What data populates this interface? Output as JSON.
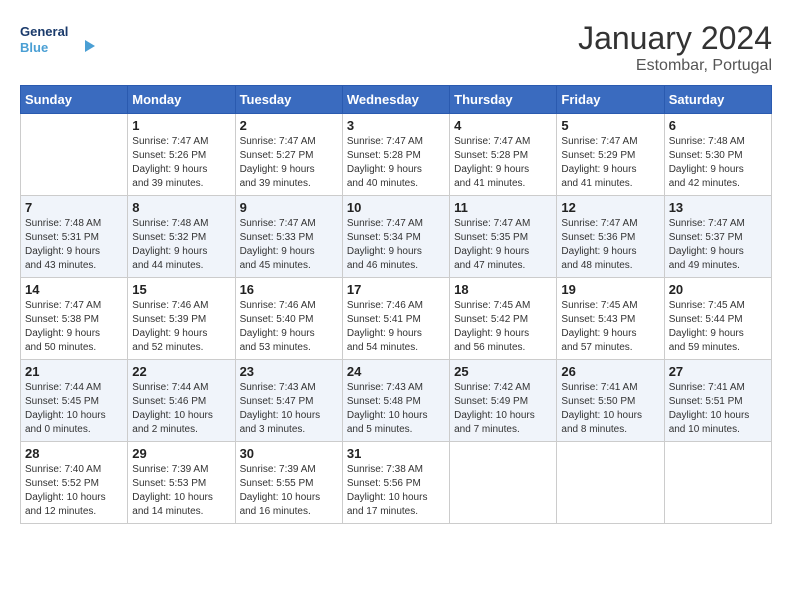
{
  "header": {
    "logo_line1": "General",
    "logo_line2": "Blue",
    "month": "January 2024",
    "location": "Estombar, Portugal"
  },
  "weekdays": [
    "Sunday",
    "Monday",
    "Tuesday",
    "Wednesday",
    "Thursday",
    "Friday",
    "Saturday"
  ],
  "weeks": [
    [
      {
        "day": "",
        "info": ""
      },
      {
        "day": "1",
        "info": "Sunrise: 7:47 AM\nSunset: 5:26 PM\nDaylight: 9 hours\nand 39 minutes."
      },
      {
        "day": "2",
        "info": "Sunrise: 7:47 AM\nSunset: 5:27 PM\nDaylight: 9 hours\nand 39 minutes."
      },
      {
        "day": "3",
        "info": "Sunrise: 7:47 AM\nSunset: 5:28 PM\nDaylight: 9 hours\nand 40 minutes."
      },
      {
        "day": "4",
        "info": "Sunrise: 7:47 AM\nSunset: 5:28 PM\nDaylight: 9 hours\nand 41 minutes."
      },
      {
        "day": "5",
        "info": "Sunrise: 7:47 AM\nSunset: 5:29 PM\nDaylight: 9 hours\nand 41 minutes."
      },
      {
        "day": "6",
        "info": "Sunrise: 7:48 AM\nSunset: 5:30 PM\nDaylight: 9 hours\nand 42 minutes."
      }
    ],
    [
      {
        "day": "7",
        "info": "Sunrise: 7:48 AM\nSunset: 5:31 PM\nDaylight: 9 hours\nand 43 minutes."
      },
      {
        "day": "8",
        "info": "Sunrise: 7:48 AM\nSunset: 5:32 PM\nDaylight: 9 hours\nand 44 minutes."
      },
      {
        "day": "9",
        "info": "Sunrise: 7:47 AM\nSunset: 5:33 PM\nDaylight: 9 hours\nand 45 minutes."
      },
      {
        "day": "10",
        "info": "Sunrise: 7:47 AM\nSunset: 5:34 PM\nDaylight: 9 hours\nand 46 minutes."
      },
      {
        "day": "11",
        "info": "Sunrise: 7:47 AM\nSunset: 5:35 PM\nDaylight: 9 hours\nand 47 minutes."
      },
      {
        "day": "12",
        "info": "Sunrise: 7:47 AM\nSunset: 5:36 PM\nDaylight: 9 hours\nand 48 minutes."
      },
      {
        "day": "13",
        "info": "Sunrise: 7:47 AM\nSunset: 5:37 PM\nDaylight: 9 hours\nand 49 minutes."
      }
    ],
    [
      {
        "day": "14",
        "info": "Sunrise: 7:47 AM\nSunset: 5:38 PM\nDaylight: 9 hours\nand 50 minutes."
      },
      {
        "day": "15",
        "info": "Sunrise: 7:46 AM\nSunset: 5:39 PM\nDaylight: 9 hours\nand 52 minutes."
      },
      {
        "day": "16",
        "info": "Sunrise: 7:46 AM\nSunset: 5:40 PM\nDaylight: 9 hours\nand 53 minutes."
      },
      {
        "day": "17",
        "info": "Sunrise: 7:46 AM\nSunset: 5:41 PM\nDaylight: 9 hours\nand 54 minutes."
      },
      {
        "day": "18",
        "info": "Sunrise: 7:45 AM\nSunset: 5:42 PM\nDaylight: 9 hours\nand 56 minutes."
      },
      {
        "day": "19",
        "info": "Sunrise: 7:45 AM\nSunset: 5:43 PM\nDaylight: 9 hours\nand 57 minutes."
      },
      {
        "day": "20",
        "info": "Sunrise: 7:45 AM\nSunset: 5:44 PM\nDaylight: 9 hours\nand 59 minutes."
      }
    ],
    [
      {
        "day": "21",
        "info": "Sunrise: 7:44 AM\nSunset: 5:45 PM\nDaylight: 10 hours\nand 0 minutes."
      },
      {
        "day": "22",
        "info": "Sunrise: 7:44 AM\nSunset: 5:46 PM\nDaylight: 10 hours\nand 2 minutes."
      },
      {
        "day": "23",
        "info": "Sunrise: 7:43 AM\nSunset: 5:47 PM\nDaylight: 10 hours\nand 3 minutes."
      },
      {
        "day": "24",
        "info": "Sunrise: 7:43 AM\nSunset: 5:48 PM\nDaylight: 10 hours\nand 5 minutes."
      },
      {
        "day": "25",
        "info": "Sunrise: 7:42 AM\nSunset: 5:49 PM\nDaylight: 10 hours\nand 7 minutes."
      },
      {
        "day": "26",
        "info": "Sunrise: 7:41 AM\nSunset: 5:50 PM\nDaylight: 10 hours\nand 8 minutes."
      },
      {
        "day": "27",
        "info": "Sunrise: 7:41 AM\nSunset: 5:51 PM\nDaylight: 10 hours\nand 10 minutes."
      }
    ],
    [
      {
        "day": "28",
        "info": "Sunrise: 7:40 AM\nSunset: 5:52 PM\nDaylight: 10 hours\nand 12 minutes."
      },
      {
        "day": "29",
        "info": "Sunrise: 7:39 AM\nSunset: 5:53 PM\nDaylight: 10 hours\nand 14 minutes."
      },
      {
        "day": "30",
        "info": "Sunrise: 7:39 AM\nSunset: 5:55 PM\nDaylight: 10 hours\nand 16 minutes."
      },
      {
        "day": "31",
        "info": "Sunrise: 7:38 AM\nSunset: 5:56 PM\nDaylight: 10 hours\nand 17 minutes."
      },
      {
        "day": "",
        "info": ""
      },
      {
        "day": "",
        "info": ""
      },
      {
        "day": "",
        "info": ""
      }
    ]
  ]
}
